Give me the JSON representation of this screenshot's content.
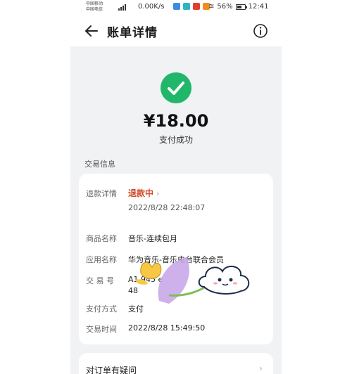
{
  "status_bar": {
    "carrier1": "中国移动",
    "carrier2": "中国电信",
    "speed": "0.00K/s",
    "battery": "56%",
    "time": "12:41"
  },
  "header": {
    "title": "账单详情"
  },
  "summary": {
    "amount": "¥18.00",
    "status": "支付成功"
  },
  "section_title": "交易信息",
  "details": {
    "refund_label": "退款详情",
    "refund_value": "退款中",
    "refund_time": "2022/8/28 22:48:07",
    "product_label": "商品名称",
    "product_value": "音乐-连续包月",
    "app_label": "应用名称",
    "app_value": "华为音乐-音乐电台联合会员",
    "txn_label": "交 易 号",
    "txn_value": "A1                945                e",
    "txn_value2": "48",
    "paymethod_label": "支付方式",
    "paymethod_value": "支付",
    "time_label": "交易时间",
    "time_value": "2022/8/28 15:49:50"
  },
  "dispute": {
    "label": "对订单有疑问"
  },
  "colors": {
    "success": "#21b76b",
    "refund": "#d04a2a",
    "panel": "#f1f2f4"
  }
}
